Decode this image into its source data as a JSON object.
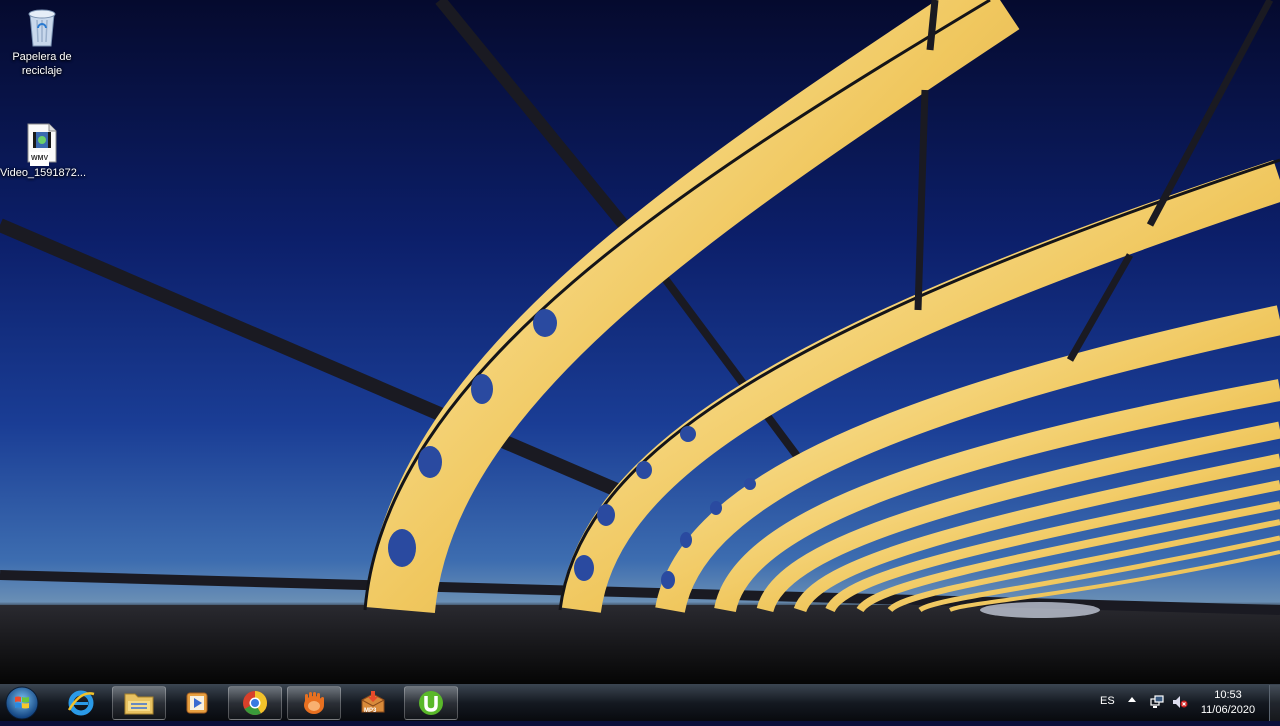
{
  "desktop": {
    "icons": [
      {
        "label": "Papelera de reciclaje",
        "icon": "recycle-bin-icon"
      },
      {
        "label": "Video_1591872...",
        "icon": "wmv-file-icon",
        "badge": "WMV"
      }
    ]
  },
  "taskbar": {
    "start": {
      "icon": "windows-orb-icon"
    },
    "apps": [
      {
        "name": "internet-explorer",
        "icon": "ie-icon",
        "active": false
      },
      {
        "name": "file-explorer",
        "icon": "folder-icon",
        "active": true
      },
      {
        "name": "media-player",
        "icon": "media-player-icon",
        "active": false
      },
      {
        "name": "chrome",
        "icon": "chrome-icon",
        "active": true
      },
      {
        "name": "app-hand",
        "icon": "hand-app-icon",
        "active": true
      },
      {
        "name": "mp3-app",
        "icon": "mp3-icon",
        "badge": "MP3",
        "active": false
      },
      {
        "name": "utorrent",
        "icon": "utorrent-icon",
        "active": true
      }
    ],
    "tray": {
      "language": "ES",
      "time": "10:53",
      "date": "11/06/2020"
    }
  },
  "colors": {
    "sky_top": "#050a2e",
    "sky_mid": "#1a3d95",
    "arch_gold": "#f2cf6e",
    "taskbar": "#141a22"
  }
}
